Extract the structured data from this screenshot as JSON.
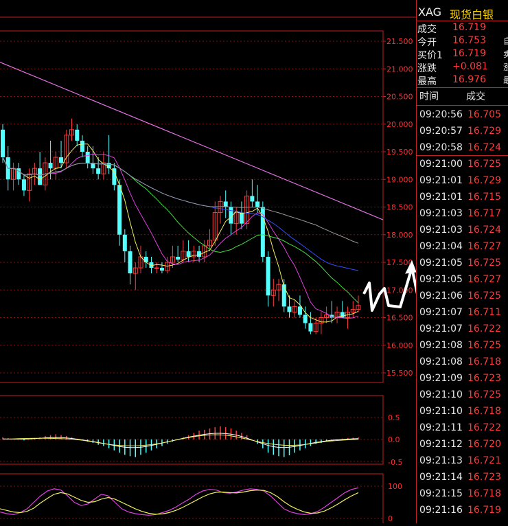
{
  "header": {
    "symbol": "XAG",
    "name": "现货白银"
  },
  "quote": [
    {
      "label": "成交",
      "value": "16.719",
      "extra": ""
    },
    {
      "label": "今开",
      "value": "16.753",
      "extra": "自"
    },
    {
      "label": "买价1",
      "value": "16.719",
      "extra": "卖"
    },
    {
      "label": "涨跌",
      "value": "+0.081",
      "extra": "涨"
    },
    {
      "label": "最高",
      "value": "16.976",
      "extra": "最"
    }
  ],
  "trades_header": {
    "time": "时间",
    "price": "成交"
  },
  "trades": [
    {
      "time": "09:20:56",
      "price": "16.705"
    },
    {
      "time": "09:20:57",
      "price": "16.729"
    },
    {
      "time": "09:20:58",
      "price": "16.724"
    },
    {
      "time": "09:21:00",
      "price": "16.725"
    },
    {
      "time": "09:21:01",
      "price": "16.729"
    },
    {
      "time": "09:21:01",
      "price": "16.715"
    },
    {
      "time": "09:21:03",
      "price": "16.717"
    },
    {
      "time": "09:21:03",
      "price": "16.724"
    },
    {
      "time": "09:21:04",
      "price": "16.727"
    },
    {
      "time": "09:21:05",
      "price": "16.725"
    },
    {
      "time": "09:21:05",
      "price": "16.727"
    },
    {
      "time": "09:21:06",
      "price": "16.725"
    },
    {
      "time": "09:21:07",
      "price": "16.711"
    },
    {
      "time": "09:21:07",
      "price": "16.722"
    },
    {
      "time": "09:21:08",
      "price": "16.725"
    },
    {
      "time": "09:21:08",
      "price": "16.718"
    },
    {
      "time": "09:21:09",
      "price": "16.723"
    },
    {
      "time": "09:21:10",
      "price": "16.725"
    },
    {
      "time": "09:21:10",
      "price": "16.718"
    },
    {
      "time": "09:21:11",
      "price": "16.722"
    },
    {
      "time": "09:21:12",
      "price": "16.720"
    },
    {
      "time": "09:21:13",
      "price": "16.721"
    },
    {
      "time": "09:21:14",
      "price": "16.723"
    },
    {
      "time": "09:21:15",
      "price": "16.718"
    },
    {
      "time": "09:21:16",
      "price": "16.719"
    }
  ],
  "chart_data": {
    "type": "candlestick",
    "price_axis": {
      "ticks": [
        "21.500",
        "21.000",
        "20.500",
        "20.000",
        "19.500",
        "19.000",
        "18.500",
        "18.000",
        "17.500",
        "17.000",
        "16.500",
        "16.000",
        "15.500"
      ],
      "ylim": [
        15.5,
        21.5
      ]
    },
    "macd_axis": {
      "ticks": [
        "0.5",
        "0.0",
        "-0.5"
      ]
    },
    "osc_axis": {
      "ticks": [
        "100",
        "0"
      ]
    },
    "candles": [
      {
        "o": 19.9,
        "h": 20.0,
        "l": 19.3,
        "c": 19.4
      },
      {
        "o": 19.4,
        "h": 19.6,
        "l": 18.8,
        "c": 19.0
      },
      {
        "o": 19.0,
        "h": 19.3,
        "l": 18.8,
        "c": 19.2
      },
      {
        "o": 19.2,
        "h": 19.3,
        "l": 18.9,
        "c": 19.0
      },
      {
        "o": 19.0,
        "h": 19.1,
        "l": 18.7,
        "c": 18.8
      },
      {
        "o": 18.8,
        "h": 19.2,
        "l": 18.6,
        "c": 19.1
      },
      {
        "o": 19.1,
        "h": 19.3,
        "l": 18.9,
        "c": 19.2
      },
      {
        "o": 19.2,
        "h": 19.5,
        "l": 18.9,
        "c": 18.9
      },
      {
        "o": 18.9,
        "h": 19.4,
        "l": 18.8,
        "c": 19.3
      },
      {
        "o": 19.3,
        "h": 19.7,
        "l": 19.0,
        "c": 19.2
      },
      {
        "o": 19.2,
        "h": 19.5,
        "l": 19.0,
        "c": 19.4
      },
      {
        "o": 19.4,
        "h": 19.7,
        "l": 19.2,
        "c": 19.3
      },
      {
        "o": 19.3,
        "h": 19.9,
        "l": 19.2,
        "c": 19.8
      },
      {
        "o": 19.8,
        "h": 20.1,
        "l": 19.7,
        "c": 19.9
      },
      {
        "o": 19.9,
        "h": 20.0,
        "l": 19.6,
        "c": 19.7
      },
      {
        "o": 19.7,
        "h": 19.8,
        "l": 19.4,
        "c": 19.5
      },
      {
        "o": 19.5,
        "h": 19.6,
        "l": 19.2,
        "c": 19.3
      },
      {
        "o": 19.3,
        "h": 19.6,
        "l": 19.1,
        "c": 19.2
      },
      {
        "o": 19.2,
        "h": 19.4,
        "l": 19.0,
        "c": 19.1
      },
      {
        "o": 19.1,
        "h": 19.5,
        "l": 19.0,
        "c": 19.3
      },
      {
        "o": 19.3,
        "h": 19.8,
        "l": 19.1,
        "c": 19.2
      },
      {
        "o": 19.2,
        "h": 19.3,
        "l": 18.8,
        "c": 18.9
      },
      {
        "o": 18.9,
        "h": 19.0,
        "l": 17.8,
        "c": 18.0
      },
      {
        "o": 18.0,
        "h": 18.1,
        "l": 17.5,
        "c": 17.7
      },
      {
        "o": 17.7,
        "h": 17.8,
        "l": 17.1,
        "c": 17.3
      },
      {
        "o": 17.3,
        "h": 17.5,
        "l": 17.0,
        "c": 17.4
      },
      {
        "o": 17.4,
        "h": 17.8,
        "l": 17.3,
        "c": 17.6
      },
      {
        "o": 17.6,
        "h": 17.7,
        "l": 17.4,
        "c": 17.5
      },
      {
        "o": 17.5,
        "h": 17.6,
        "l": 17.3,
        "c": 17.4
      },
      {
        "o": 17.4,
        "h": 17.5,
        "l": 17.3,
        "c": 17.4
      },
      {
        "o": 17.4,
        "h": 17.5,
        "l": 17.3,
        "c": 17.35
      },
      {
        "o": 17.35,
        "h": 17.6,
        "l": 17.3,
        "c": 17.5
      },
      {
        "o": 17.5,
        "h": 17.8,
        "l": 17.4,
        "c": 17.6
      },
      {
        "o": 17.6,
        "h": 17.8,
        "l": 17.5,
        "c": 17.55
      },
      {
        "o": 17.55,
        "h": 17.9,
        "l": 17.5,
        "c": 17.7
      },
      {
        "o": 17.7,
        "h": 17.9,
        "l": 17.5,
        "c": 17.6
      },
      {
        "o": 17.6,
        "h": 17.8,
        "l": 17.5,
        "c": 17.7
      },
      {
        "o": 17.7,
        "h": 17.8,
        "l": 17.5,
        "c": 17.6
      },
      {
        "o": 17.6,
        "h": 17.9,
        "l": 17.5,
        "c": 17.8
      },
      {
        "o": 17.8,
        "h": 18.1,
        "l": 17.7,
        "c": 17.9
      },
      {
        "o": 17.9,
        "h": 18.6,
        "l": 17.8,
        "c": 18.4
      },
      {
        "o": 18.4,
        "h": 18.7,
        "l": 18.2,
        "c": 18.6
      },
      {
        "o": 18.6,
        "h": 18.8,
        "l": 18.3,
        "c": 18.5
      },
      {
        "o": 18.5,
        "h": 18.6,
        "l": 18.0,
        "c": 18.2
      },
      {
        "o": 18.2,
        "h": 18.5,
        "l": 18.0,
        "c": 18.4
      },
      {
        "o": 18.4,
        "h": 18.6,
        "l": 18.1,
        "c": 18.2
      },
      {
        "o": 18.2,
        "h": 18.8,
        "l": 18.1,
        "c": 18.7
      },
      {
        "o": 18.7,
        "h": 19.0,
        "l": 18.5,
        "c": 18.6
      },
      {
        "o": 18.6,
        "h": 18.9,
        "l": 18.4,
        "c": 18.5
      },
      {
        "o": 18.5,
        "h": 18.6,
        "l": 17.5,
        "c": 17.6
      },
      {
        "o": 17.6,
        "h": 17.7,
        "l": 16.7,
        "c": 16.9
      },
      {
        "o": 16.9,
        "h": 17.2,
        "l": 16.7,
        "c": 17.0
      },
      {
        "o": 17.0,
        "h": 17.2,
        "l": 16.8,
        "c": 17.1
      },
      {
        "o": 17.1,
        "h": 17.2,
        "l": 16.6,
        "c": 16.7
      },
      {
        "o": 16.7,
        "h": 16.9,
        "l": 16.5,
        "c": 16.6
      },
      {
        "o": 16.6,
        "h": 16.8,
        "l": 16.5,
        "c": 16.7
      },
      {
        "o": 16.7,
        "h": 16.9,
        "l": 16.5,
        "c": 16.55
      },
      {
        "o": 16.55,
        "h": 16.7,
        "l": 16.3,
        "c": 16.4
      },
      {
        "o": 16.4,
        "h": 16.6,
        "l": 16.2,
        "c": 16.25
      },
      {
        "o": 16.25,
        "h": 16.5,
        "l": 16.2,
        "c": 16.4
      },
      {
        "o": 16.4,
        "h": 16.6,
        "l": 16.2,
        "c": 16.5
      },
      {
        "o": 16.5,
        "h": 16.7,
        "l": 16.4,
        "c": 16.55
      },
      {
        "o": 16.55,
        "h": 16.8,
        "l": 16.4,
        "c": 16.5
      },
      {
        "o": 16.5,
        "h": 16.7,
        "l": 16.4,
        "c": 16.6
      },
      {
        "o": 16.6,
        "h": 16.8,
        "l": 16.5,
        "c": 16.5
      },
      {
        "o": 16.5,
        "h": 16.7,
        "l": 16.3,
        "c": 16.6
      },
      {
        "o": 16.6,
        "h": 16.8,
        "l": 16.5,
        "c": 16.65
      },
      {
        "o": 16.65,
        "h": 16.9,
        "l": 16.6,
        "c": 16.72
      }
    ],
    "trendline": {
      "from": 21.12,
      "to": 18.27
    },
    "macd": [
      0.05,
      0.03,
      0.02,
      0.0,
      -0.02,
      0.0,
      0.02,
      0.05,
      0.08,
      0.1,
      0.12,
      0.1,
      0.08,
      0.05,
      0.02,
      -0.02,
      -0.05,
      -0.08,
      -0.12,
      -0.15,
      -0.2,
      -0.25,
      -0.3,
      -0.35,
      -0.38,
      -0.4,
      -0.35,
      -0.3,
      -0.25,
      -0.2,
      -0.15,
      -0.1,
      -0.05,
      0.0,
      0.05,
      0.1,
      0.15,
      0.2,
      0.22,
      0.25,
      0.28,
      0.3,
      0.28,
      0.25,
      0.2,
      0.15,
      0.1,
      0.0,
      -0.1,
      -0.2,
      -0.3,
      -0.35,
      -0.38,
      -0.4,
      -0.36,
      -0.3,
      -0.25,
      -0.2,
      -0.15,
      -0.1,
      -0.08,
      -0.05,
      -0.03,
      0.0,
      0.02,
      0.03,
      0.04,
      0.05
    ],
    "osc_k": [
      20,
      15,
      12,
      18,
      30,
      50,
      70,
      85,
      92,
      88,
      70,
      50,
      40,
      45,
      60,
      75,
      70,
      50,
      30,
      20,
      15,
      12,
      10,
      12,
      18,
      25,
      35,
      48,
      60,
      75,
      85,
      90,
      88,
      80,
      78,
      82,
      88,
      92,
      90,
      85,
      70,
      50,
      30,
      20,
      15,
      12,
      15,
      22,
      35,
      50,
      65,
      80,
      90,
      95
    ],
    "osc_d": [
      30,
      25,
      20,
      18,
      22,
      32,
      48,
      62,
      75,
      80,
      76,
      66,
      56,
      50,
      52,
      60,
      65,
      60,
      50,
      40,
      30,
      22,
      16,
      13,
      14,
      18,
      25,
      34,
      45,
      56,
      67,
      76,
      81,
      82,
      80,
      79,
      82,
      86,
      88,
      87,
      80,
      68,
      52,
      38,
      28,
      20,
      16,
      17,
      23,
      33,
      45,
      58,
      70,
      80
    ]
  }
}
